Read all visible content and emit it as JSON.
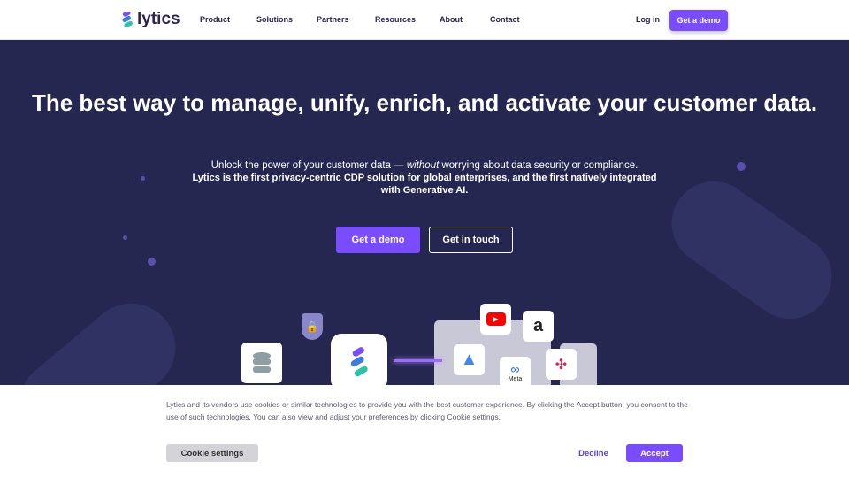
{
  "nav": {
    "logo": "lytics",
    "items": [
      "Product",
      "Solutions",
      "Partners",
      "Resources",
      "About",
      "Contact"
    ],
    "login": "Log in",
    "demo": "Get a demo"
  },
  "hero": {
    "title": "The best way to manage, unify, enrich, and activate your customer data.",
    "sub_pre": "Unlock the power of your customer data — ",
    "sub_em": "without",
    "sub_post": " worrying about data security or compliance.",
    "sub_bold": "Lytics is the first privacy-centric CDP solution for global enterprises, and the first natively integrated with Generative AI.",
    "cta_primary": "Get a demo",
    "cta_secondary": "Get in touch",
    "meta_label": "Meta"
  },
  "cookie": {
    "text": "Lytics and its vendors use cookies or similar technologies to provide you with the best customer experience. By clicking the Accept button, you consent to the use of such technologies. You can also view and adjust your preferences by clicking Cookie settings.",
    "settings": "Cookie settings",
    "decline": "Decline",
    "accept": "Accept"
  }
}
